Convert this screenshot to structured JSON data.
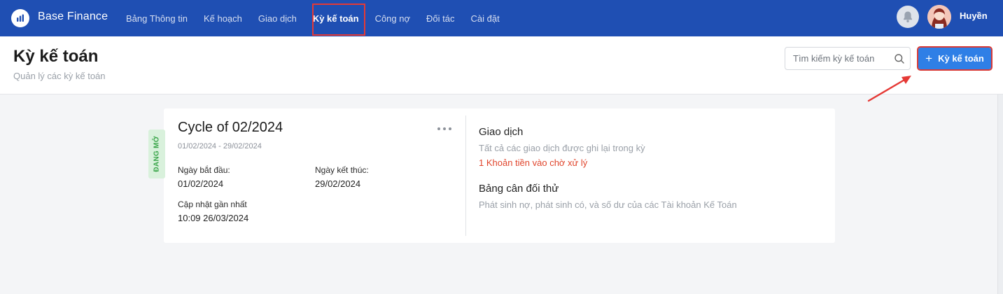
{
  "app": {
    "name": "Base Finance",
    "colors": {
      "nav_bg": "#1f4fb3",
      "primary_button": "#2f7fe6",
      "highlight": "#e53935",
      "status_open": "#3aa54a",
      "alert": "#e0452c"
    }
  },
  "nav": {
    "items": [
      {
        "label": "Bảng Thông tin",
        "active": false
      },
      {
        "label": "Kế hoạch",
        "active": false
      },
      {
        "label": "Giao dịch",
        "active": false
      },
      {
        "label": "Kỳ kế toán",
        "active": true
      },
      {
        "label": "Công nợ",
        "active": false
      },
      {
        "label": "Đối tác",
        "active": false
      },
      {
        "label": "Cài đặt",
        "active": false
      }
    ],
    "icons": {
      "logo": "chart-logo-icon",
      "bell": "bell-icon"
    },
    "user": {
      "name": "Huyền"
    }
  },
  "header": {
    "title": "Kỳ kế toán",
    "subtitle": "Quản lý các kỳ kế toán",
    "search_placeholder": "Tìm kiếm kỳ kế toán",
    "add_button_label": "Kỳ kế toán",
    "add_button_icon": "plus-icon"
  },
  "cycle": {
    "status": "ĐANG MỞ",
    "title": "Cycle of 02/2024",
    "range": "01/02/2024 - 29/02/2024",
    "start_label": "Ngày bắt đầu:",
    "start_value": "01/02/2024",
    "end_label": "Ngày kết thúc:",
    "end_value": "29/02/2024",
    "updated_label": "Cập nhật gần nhất",
    "updated_value": "10:09 26/03/2024",
    "sections": [
      {
        "title": "Giao dịch",
        "description": "Tất cả các giao dịch được ghi lại trong kỳ",
        "alert": "1 Khoản tiền vào chờ xử lý"
      },
      {
        "title": "Bảng cân đối thử",
        "description": "Phát sinh nợ, phát sinh có, và số dư của các Tài khoản Kế Toán"
      }
    ]
  }
}
